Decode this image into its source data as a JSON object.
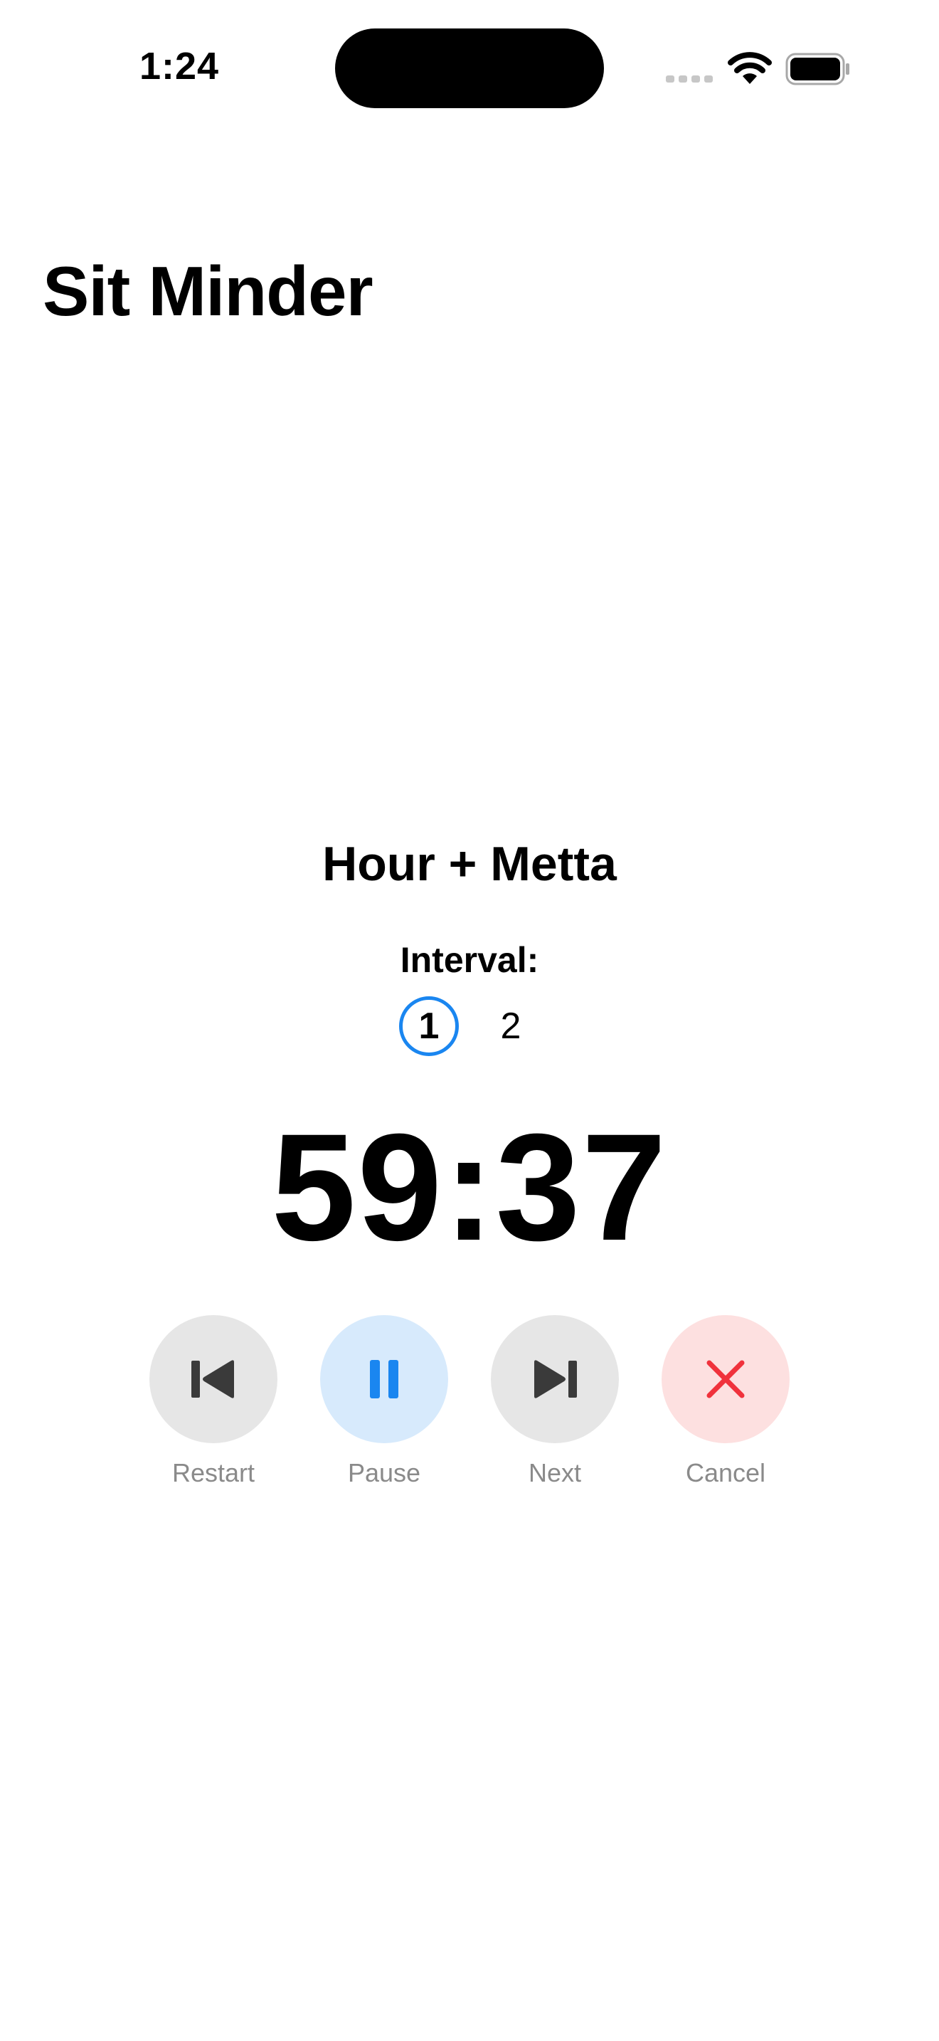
{
  "status_bar": {
    "time": "1:24",
    "icons": [
      "signal-icon",
      "wifi-icon",
      "battery-icon"
    ]
  },
  "app": {
    "title": "Sit Minder"
  },
  "session": {
    "name": "Hour + Metta",
    "interval_label": "Interval:",
    "intervals": [
      "1",
      "2"
    ],
    "active_interval": "1",
    "timer": "59:37"
  },
  "controls": [
    {
      "label": "Restart",
      "icon": "skip-back-icon",
      "color": "#3a3a3a"
    },
    {
      "label": "Pause",
      "icon": "pause-icon",
      "color": "#1a86f0"
    },
    {
      "label": "Next",
      "icon": "skip-forward-icon",
      "color": "#3a3a3a"
    },
    {
      "label": "Cancel",
      "icon": "close-icon",
      "color": "#f0323c"
    }
  ],
  "colors": {
    "accent": "#1a86f0",
    "danger": "#f0323c",
    "control_bg_gray": "#e6e6e6",
    "control_bg_blue": "#d7eafc",
    "control_bg_red": "#fde0e0",
    "label_gray": "#8a8a8a"
  }
}
